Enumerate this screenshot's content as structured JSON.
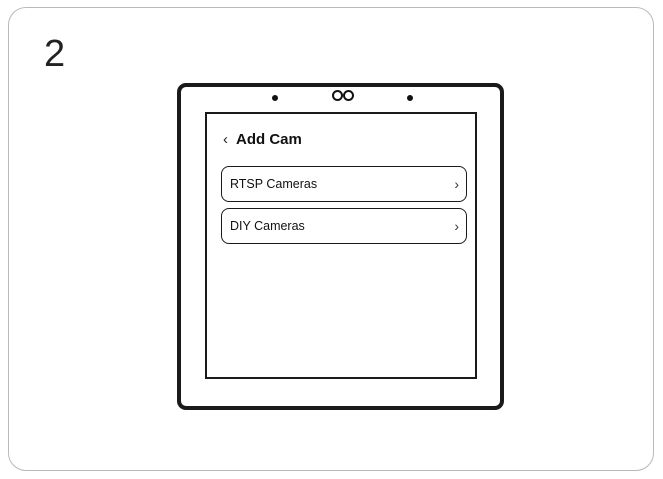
{
  "step": {
    "number": "2"
  },
  "screen": {
    "header": {
      "back_icon": "chevron-left-icon",
      "back_glyph": "‹",
      "title": "Add Cam"
    },
    "items": [
      {
        "label": "RTSP Cameras",
        "chevron_glyph": "›",
        "icon": "chevron-right-icon"
      },
      {
        "label": "DIY Cameras",
        "chevron_glyph": "›",
        "icon": "chevron-right-icon"
      }
    ]
  },
  "colors": {
    "frame": "#1a1a1a",
    "card_border": "#b9b9b9",
    "background": "#ffffff",
    "text": "#111111"
  }
}
